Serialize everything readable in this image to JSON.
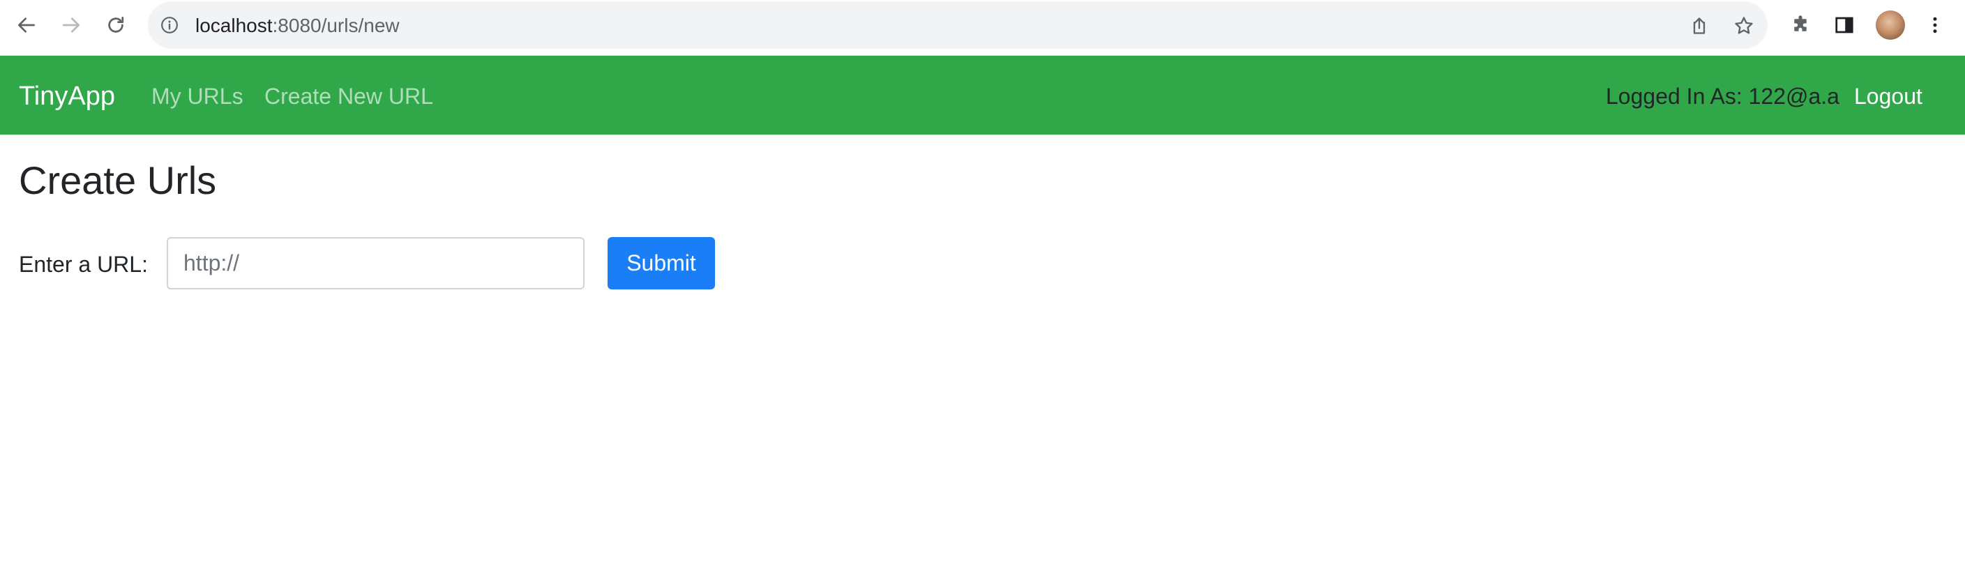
{
  "browser": {
    "url_host": "localhost",
    "url_path": ":8080/urls/new",
    "icons": [
      "back-arrow-icon",
      "forward-arrow-icon",
      "reload-icon",
      "site-info-icon",
      "share-icon",
      "bookmark-star-icon",
      "extensions-icon",
      "side-panel-icon",
      "profile-avatar",
      "kebab-menu-icon"
    ]
  },
  "navbar": {
    "brand": "TinyApp",
    "links": [
      "My URLs",
      "Create New URL"
    ],
    "logged_in_text": "Logged In As: 122@a.a",
    "logout_label": "Logout",
    "background_color": "#30a84a"
  },
  "main": {
    "title": "Create Urls",
    "form": {
      "label": "Enter a URL:",
      "input_placeholder": "http://",
      "input_value": "",
      "submit_label": "Submit",
      "submit_color": "#1a7ef6"
    }
  }
}
